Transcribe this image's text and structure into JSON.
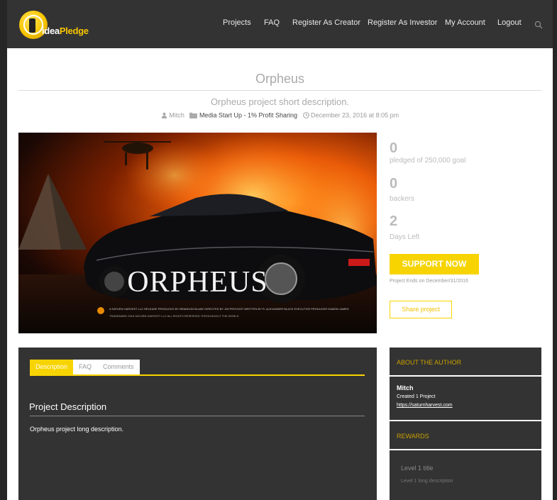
{
  "brand": {
    "logo_text_a": "idea",
    "logo_text_b": "Pledge",
    "logo_color": "#f7c500"
  },
  "nav": [
    {
      "label": "Projects"
    },
    {
      "label": "FAQ"
    },
    {
      "label": "Register As Creator"
    },
    {
      "label": "Register As Investor"
    },
    {
      "label": "My Account"
    },
    {
      "label": "Logout"
    }
  ],
  "project": {
    "title": "Orpheus",
    "short_description": "Orpheus project short description.",
    "author": "Mitch",
    "category": "Media Start Up - 1% Profit Sharing",
    "date": "December 23, 2016 at 8:05 pm",
    "poster_title": "ORPHEUS",
    "poster_credits_1": "A SATURN HARVEST LLC RELEASE PRODUCED BY BRANDON BLAKE DIRECTED BY JIM PROVOST WRITTEN BY R. ALEXANDER BLACK EXECUTIVE PRODUCER DAMON JAMES",
    "poster_credits_2": "TRADEMARK 2016 SATURN HARVEST LLC ALL RIGHTS RESERVED THROUGHOUT THE WORLD"
  },
  "stats": {
    "pledged_value": "0",
    "pledged_label": "pledged of 250,000 goal",
    "backers_value": "0",
    "backers_label": "backers",
    "days_value": "2",
    "days_label": "Days Left",
    "support_label": "SUPPORT NOW",
    "ends_text": "Project Ends on December/31/2016",
    "share_label": "Share project",
    "accent": "#f7d400"
  },
  "tabs": [
    {
      "label": "Description",
      "active": true
    },
    {
      "label": "FAQ",
      "active": false
    },
    {
      "label": "Comments",
      "active": false
    }
  ],
  "description": {
    "heading": "Project Description",
    "text": "Orpheus project long description."
  },
  "sidebar": {
    "about_heading": "ABOUT THE AUTHOR",
    "author_name": "Mitch",
    "author_created": "Created 1 Project",
    "author_link": "https://saturnharvest.com",
    "rewards_heading": "REWARDS",
    "reward_title": "Level 1 title",
    "reward_desc": "Level 1 long description"
  }
}
